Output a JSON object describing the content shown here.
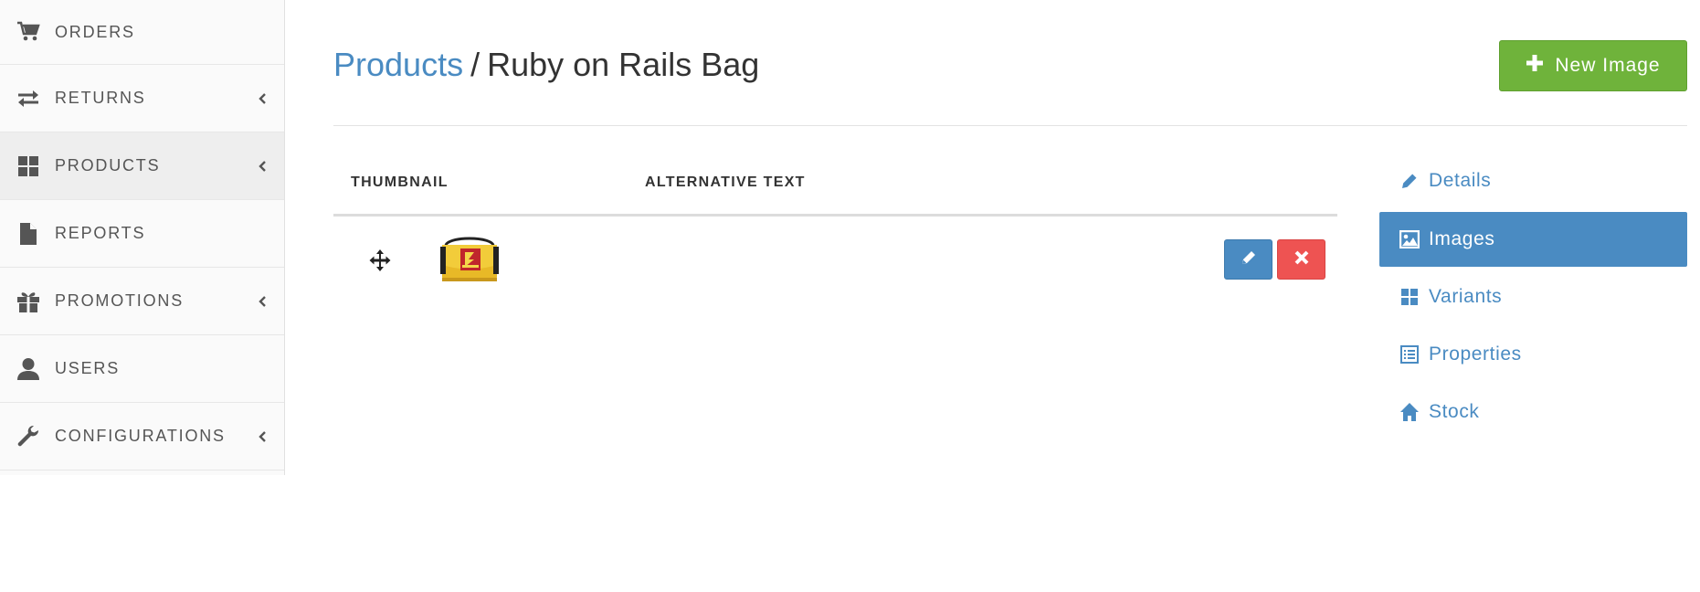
{
  "sidebar": {
    "items": [
      {
        "label": "ORDERS",
        "icon": "cart-icon",
        "has_chevron": false,
        "active": false
      },
      {
        "label": "RETURNS",
        "icon": "exchange-icon",
        "has_chevron": true,
        "active": false
      },
      {
        "label": "PRODUCTS",
        "icon": "grid-icon",
        "has_chevron": true,
        "active": true
      },
      {
        "label": "REPORTS",
        "icon": "file-icon",
        "has_chevron": false,
        "active": false
      },
      {
        "label": "PROMOTIONS",
        "icon": "gift-icon",
        "has_chevron": true,
        "active": false
      },
      {
        "label": "USERS",
        "icon": "user-icon",
        "has_chevron": false,
        "active": false
      },
      {
        "label": "CONFIGURATIONS",
        "icon": "wrench-icon",
        "has_chevron": true,
        "active": false
      }
    ]
  },
  "header": {
    "breadcrumb_link": "Products",
    "separator": "/",
    "product_name": "Ruby on Rails Bag",
    "new_image_label": "New Image"
  },
  "table": {
    "columns": [
      "THUMBNAIL",
      "ALTERNATIVE TEXT"
    ],
    "rows": [
      {
        "alt_text": "",
        "thumbnail_icon": "rails-bag-thumbnail"
      }
    ]
  },
  "tabs": {
    "items": [
      {
        "label": "Details",
        "icon": "pencil-icon",
        "active": false
      },
      {
        "label": "Images",
        "icon": "picture-icon",
        "active": true
      },
      {
        "label": "Variants",
        "icon": "grid-icon",
        "active": false
      },
      {
        "label": "Properties",
        "icon": "list-icon",
        "active": false
      },
      {
        "label": "Stock",
        "icon": "home-icon",
        "active": false
      }
    ]
  },
  "colors": {
    "accent": "#4a8bc2",
    "success": "#6fb33b",
    "danger": "#ee5352"
  }
}
